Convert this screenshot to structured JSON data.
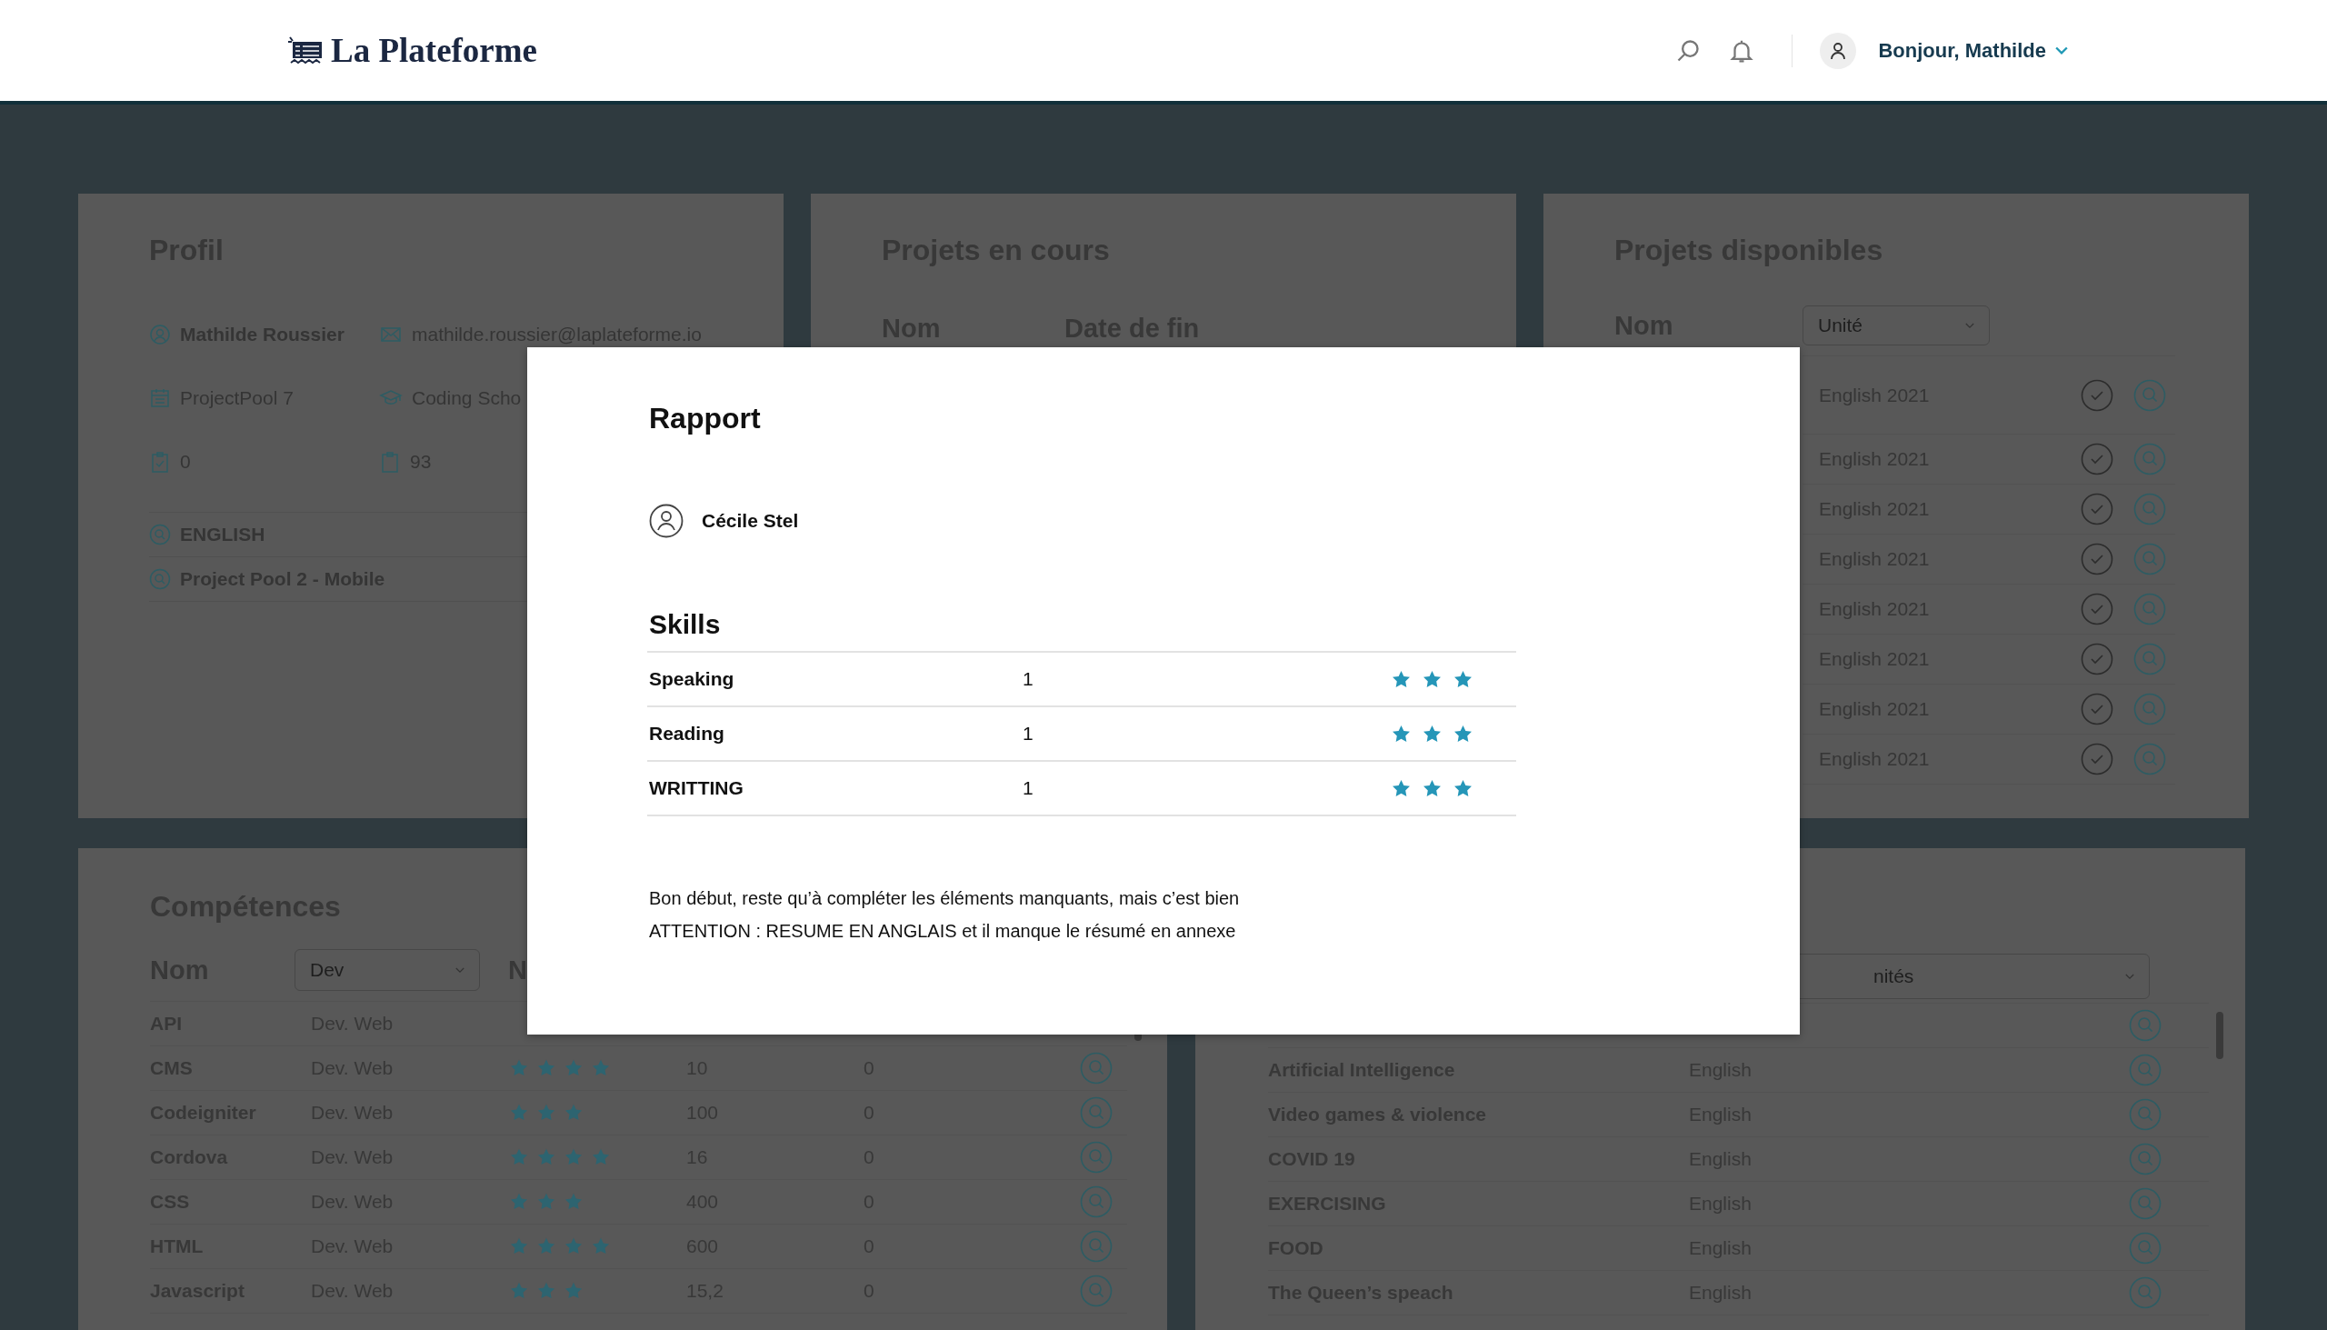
{
  "header": {
    "logo": "La Plateforme",
    "greeting": "Bonjour, Mathilde"
  },
  "profile": {
    "title": "Profil",
    "name": "Mathilde Roussier",
    "email": "mathilde.roussier@laplateforme.io",
    "pool": "ProjectPool 7",
    "school": "Coding Scho",
    "done_count": "0",
    "todo_count": "93",
    "links": [
      "ENGLISH",
      "Project Pool 2 - Mobile"
    ]
  },
  "current_projects": {
    "title": "Projets en cours",
    "columns": [
      "Nom",
      "Date de fin"
    ]
  },
  "available_projects": {
    "title": "Projets disponibles",
    "name_column": "Nom",
    "unit_filter": {
      "placeholder": "Unité"
    },
    "rows": [
      {
        "unit": "English 2021"
      },
      {
        "unit": "English 2021"
      },
      {
        "unit": "English 2021"
      },
      {
        "unit": "English 2021"
      },
      {
        "unit": "English 2021"
      },
      {
        "unit": "English 2021"
      },
      {
        "unit": "English 2021"
      },
      {
        "unit": "English 2021"
      }
    ]
  },
  "skills": {
    "title": "Compétences",
    "name_column": "Nom",
    "filter": {
      "placeholder": "Dev"
    },
    "column_3": "N",
    "rows": [
      {
        "name": "API",
        "category": "Dev. Web"
      },
      {
        "name": "CMS",
        "category": "Dev. Web",
        "stars": 4,
        "value": "10",
        "count": "0"
      },
      {
        "name": "Codeigniter",
        "category": "Dev. Web",
        "stars": 3,
        "value": "100",
        "count": "0"
      },
      {
        "name": "Cordova",
        "category": "Dev. Web",
        "stars": 4,
        "value": "16",
        "count": "0"
      },
      {
        "name": "CSS",
        "category": "Dev. Web",
        "stars": 3,
        "value": "400",
        "count": "0"
      },
      {
        "name": "HTML",
        "category": "Dev. Web",
        "stars": 4,
        "value": "600",
        "count": "0"
      },
      {
        "name": "Javascript",
        "category": "Dev. Web",
        "stars": 3,
        "value": "15,2",
        "count": "0"
      }
    ]
  },
  "units": {
    "filter": {
      "placeholder": "nités"
    },
    "rows": [
      {
        "name": "Artificial Intelligence",
        "unit": "English"
      },
      {
        "name": "Video games & violence",
        "unit": "English"
      },
      {
        "name": "COVID 19",
        "unit": "English"
      },
      {
        "name": "EXERCISING",
        "unit": "English"
      },
      {
        "name": "FOOD",
        "unit": "English"
      },
      {
        "name": "The Queen’s speach",
        "unit": "English"
      }
    ]
  },
  "report": {
    "title": "Rapport",
    "reviewer": "Cécile Stel",
    "skills_heading": "Skills",
    "skills": [
      {
        "name": "Speaking",
        "score": "1",
        "stars": 3
      },
      {
        "name": "Reading",
        "score": "1",
        "stars": 3
      },
      {
        "name": "WRITTING",
        "score": "1",
        "stars": 3
      }
    ],
    "comment": [
      "Bon début, reste qu’à compléter les éléments manquants, mais c’est bien",
      "ATTENTION : RESUME EN ANGLAIS et il manque le résumé en annexe"
    ]
  }
}
